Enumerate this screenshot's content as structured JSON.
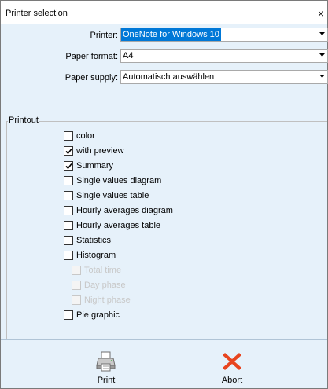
{
  "window": {
    "title": "Printer selection",
    "close_glyph": "×"
  },
  "fields": {
    "printer": {
      "label": "Printer:",
      "value": "OneNote for Windows 10"
    },
    "paper_format": {
      "label": "Paper format:",
      "value": "A4"
    },
    "paper_supply": {
      "label": "Paper supply:",
      "value": "Automatisch auswählen"
    }
  },
  "printout": {
    "title": "Printout",
    "options": [
      {
        "label": "color",
        "checked": false,
        "enabled": true
      },
      {
        "label": "with preview",
        "checked": true,
        "enabled": true
      },
      {
        "label": "Summary",
        "checked": true,
        "enabled": true
      },
      {
        "label": "Single values diagram",
        "checked": false,
        "enabled": true
      },
      {
        "label": "Single values table",
        "checked": false,
        "enabled": true
      },
      {
        "label": "Hourly averages diagram",
        "checked": false,
        "enabled": true
      },
      {
        "label": "Hourly averages table",
        "checked": false,
        "enabled": true
      },
      {
        "label": "Statistics",
        "checked": false,
        "enabled": true
      },
      {
        "label": "Histogram",
        "checked": false,
        "enabled": true
      },
      {
        "label": "Total time",
        "checked": false,
        "enabled": false
      },
      {
        "label": "Day phase",
        "checked": false,
        "enabled": false
      },
      {
        "label": "Night phase",
        "checked": false,
        "enabled": false
      },
      {
        "label": "Pie graphic",
        "checked": false,
        "enabled": true
      }
    ]
  },
  "buttons": {
    "print": {
      "label": "Print",
      "icon": "printer-icon"
    },
    "abort": {
      "label": "Abort",
      "icon": "red-x-icon",
      "color": "#e8451f"
    }
  }
}
